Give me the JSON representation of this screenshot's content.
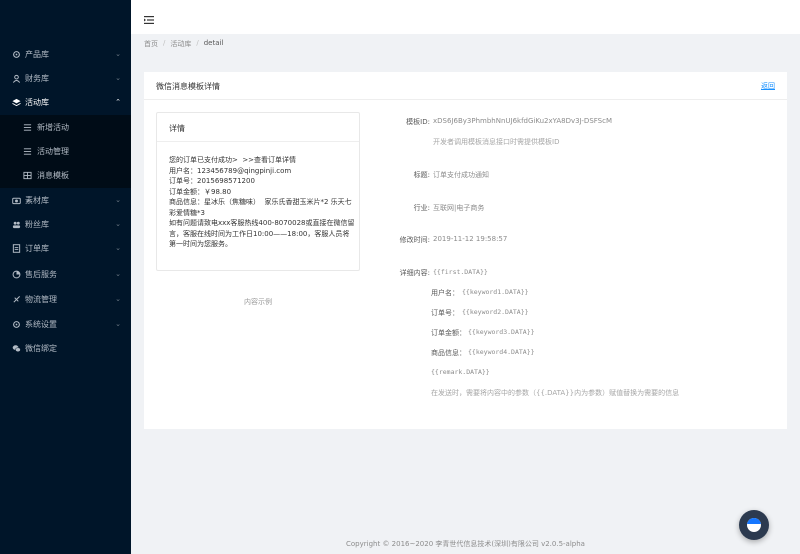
{
  "sidebar": {
    "items": [
      {
        "label": "产品库",
        "icon": "settings-icon"
      },
      {
        "label": "财务库",
        "icon": "user-icon"
      },
      {
        "label": "活动库",
        "icon": "layers-icon"
      },
      {
        "label": "素材库",
        "icon": "camera-icon"
      },
      {
        "label": "粉丝库",
        "icon": "users-icon"
      },
      {
        "label": "订单库",
        "icon": "file-icon"
      },
      {
        "label": "售后服务",
        "icon": "pie-chart-icon"
      },
      {
        "label": "物流管理",
        "icon": "rocket-icon"
      },
      {
        "label": "系统设置",
        "icon": "settings-icon"
      },
      {
        "label": "微信绑定",
        "icon": "wechat-icon"
      }
    ],
    "subitems": [
      {
        "label": "新增活动"
      },
      {
        "label": "活动管理"
      },
      {
        "label": "消息模板"
      }
    ]
  },
  "breadcrumb": {
    "home": "首页",
    "parent": "活动库",
    "current": "detail",
    "separator": "/"
  },
  "card": {
    "title": "微信消息模板详情",
    "back_label": "返回"
  },
  "preview": {
    "title": "详情",
    "lines": [
      "您的订单已支付成功>  >>查看订单详情",
      "用户名：123456789@qingpinji.com",
      "订单号：2015698571200",
      "订单金额：￥98.80",
      "商品信息：星冰乐（焦糖味）  家乐氏香甜玉米片*2 乐天七彩爱情糖*3",
      "如有问题请致电xxx客服热线400-8070028或直接在微信留言，客服在线时间为工作日10:00——18:00，客服人员将第一时间为您服务。"
    ],
    "caption": "内容示例"
  },
  "details": {
    "template_id_label": "模板ID:",
    "template_id_value": "xDS6J6By3PhmbhNnUJ6kfdGiKu2xYA8Dv3J-DSFScM",
    "template_id_hint": "开发者调用模板消息接口时需提供模板ID",
    "title_label": "标题:",
    "title_value": "订单支付成功通知",
    "industry_label": "行业:",
    "industry_value": "互联网|电子商务",
    "modified_label": "修改时间:",
    "modified_value": "2019-11-12 19:58:57",
    "content_label": "详细内容:",
    "content_first": "{{first.DATA}}",
    "fields": [
      {
        "label": "用户名：",
        "value": "{{keyword1.DATA}}"
      },
      {
        "label": "订单号：",
        "value": "{{keyword2.DATA}}"
      },
      {
        "label": "订单金额：",
        "value": "{{keyword3.DATA}}"
      },
      {
        "label": "商品信息：",
        "value": "{{keyword4.DATA}}"
      }
    ],
    "content_remark": "{{remark.DATA}}",
    "content_hint": "在发送时，需要将内容中的参数（{{.DATA}}内为参数）赋值替换为需要的信息"
  },
  "footer": {
    "text": "Copyright © 2016~2020 李青世代信息技术(深圳)有限公司  v2.0.5-alpha"
  },
  "colors": {
    "sidebar_bg": "#001529",
    "submenu_bg": "#000c17",
    "link": "#1890ff"
  }
}
